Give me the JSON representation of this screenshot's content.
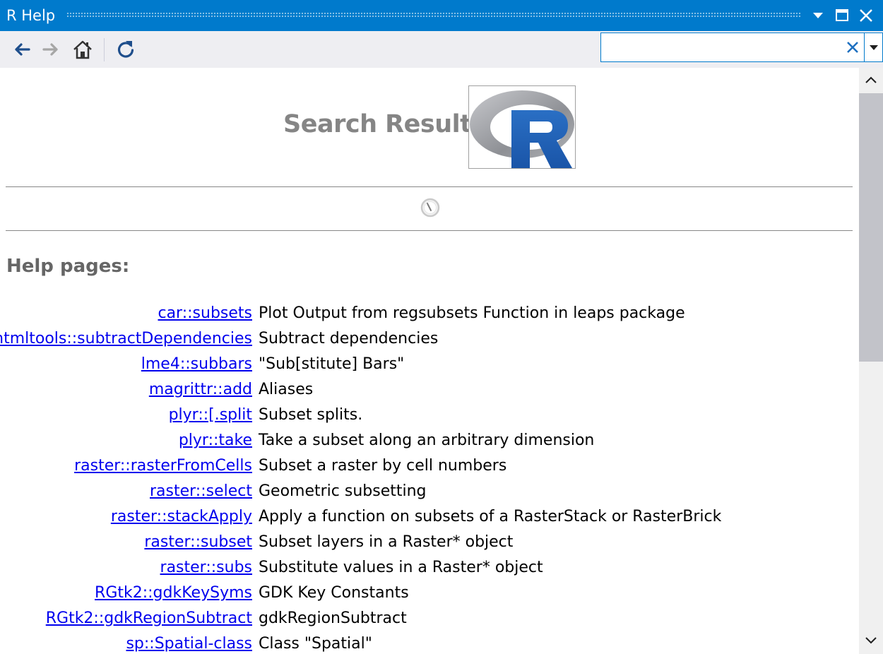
{
  "window": {
    "title": "R Help",
    "controls": [
      "dropdown-icon",
      "maximize-icon",
      "close-icon"
    ]
  },
  "toolbar": {
    "back_icon": "arrow-left-icon",
    "forward_icon": "arrow-right-icon",
    "home_icon": "home-icon",
    "refresh_icon": "refresh-icon"
  },
  "search": {
    "value": "",
    "placeholder": ""
  },
  "colors": {
    "titlebar": "#007acc",
    "link": "#0000ee",
    "heading": "#858585",
    "r_logo_blue": "#1e63b8",
    "r_logo_gray": "#9ea0a6"
  },
  "page": {
    "title": "Search Results",
    "section_heading": "Help pages:"
  },
  "results": [
    {
      "link": "car::subsets",
      "desc": "Plot Output from regsubsets Function in leaps package"
    },
    {
      "link": "htmltools::subtractDependencies",
      "desc": "Subtract dependencies"
    },
    {
      "link": "lme4::subbars",
      "desc": "\"Sub[stitute] Bars\""
    },
    {
      "link": "magrittr::add",
      "desc": "Aliases"
    },
    {
      "link": "plyr::[.split",
      "desc": "Subset splits."
    },
    {
      "link": "plyr::take",
      "desc": "Take a subset along an arbitrary dimension"
    },
    {
      "link": "raster::rasterFromCells",
      "desc": "Subset a raster by cell numbers"
    },
    {
      "link": "raster::select",
      "desc": "Geometric subsetting"
    },
    {
      "link": "raster::stackApply",
      "desc": "Apply a function on subsets of a RasterStack or RasterBrick"
    },
    {
      "link": "raster::subset",
      "desc": "Subset layers in a Raster* object"
    },
    {
      "link": "raster::subs",
      "desc": "Substitute values in a Raster* object"
    },
    {
      "link": "RGtk2::gdkKeySyms",
      "desc": "GDK Key Constants"
    },
    {
      "link": "RGtk2::gdkRegionSubtract",
      "desc": "gdkRegionSubtract"
    },
    {
      "link": "sp::Spatial-class",
      "desc": "Class \"Spatial\""
    }
  ]
}
